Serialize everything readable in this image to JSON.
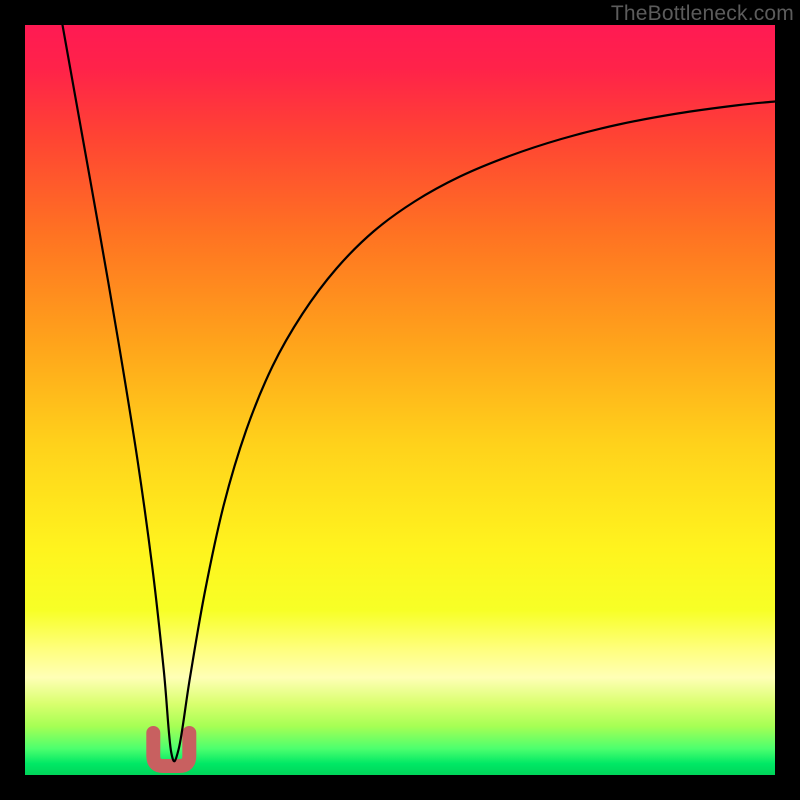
{
  "watermark": "TheBottleneck.com",
  "gradient": {
    "stops": [
      {
        "offset": 0.0,
        "color": "#ff1a53"
      },
      {
        "offset": 0.06,
        "color": "#ff2349"
      },
      {
        "offset": 0.15,
        "color": "#ff4433"
      },
      {
        "offset": 0.28,
        "color": "#ff7322"
      },
      {
        "offset": 0.42,
        "color": "#ffa21b"
      },
      {
        "offset": 0.56,
        "color": "#ffd21b"
      },
      {
        "offset": 0.7,
        "color": "#fff41e"
      },
      {
        "offset": 0.78,
        "color": "#f7ff26"
      },
      {
        "offset": 0.835,
        "color": "#ffff82"
      },
      {
        "offset": 0.87,
        "color": "#ffffb6"
      },
      {
        "offset": 0.905,
        "color": "#d9ff6e"
      },
      {
        "offset": 0.935,
        "color": "#a6ff54"
      },
      {
        "offset": 0.965,
        "color": "#4cff6e"
      },
      {
        "offset": 0.985,
        "color": "#00e865"
      },
      {
        "offset": 1.0,
        "color": "#00d45a"
      }
    ]
  },
  "marker": {
    "x": 0.195,
    "half_width": 0.024,
    "thickness": 14,
    "color": "#c86060"
  },
  "curve": {
    "color": "#000000",
    "width": 2.2
  },
  "chart_data": {
    "type": "line",
    "title": "",
    "xlabel": "",
    "ylabel": "",
    "xlim": [
      0,
      1
    ],
    "ylim": [
      0,
      1
    ],
    "note": "x and y are normalized to the plot area (0 = left/bottom, 1 = right/top). The curve is a V-shaped bottleneck profile; left branch falls steeply to near-zero at x≈0.195, right branch rises with decreasing slope toward the upper right.",
    "series": [
      {
        "name": "bottleneck-curve",
        "x": [
          0.05,
          0.075,
          0.1,
          0.125,
          0.15,
          0.17,
          0.185,
          0.195,
          0.205,
          0.22,
          0.24,
          0.265,
          0.295,
          0.33,
          0.37,
          0.415,
          0.465,
          0.52,
          0.58,
          0.645,
          0.715,
          0.79,
          0.87,
          0.95,
          1.0
        ],
        "y": [
          1.0,
          0.86,
          0.72,
          0.575,
          0.42,
          0.275,
          0.14,
          0.03,
          0.035,
          0.13,
          0.245,
          0.36,
          0.46,
          0.545,
          0.615,
          0.675,
          0.725,
          0.765,
          0.798,
          0.825,
          0.848,
          0.867,
          0.882,
          0.893,
          0.898
        ]
      }
    ],
    "optimal_x": 0.195
  }
}
